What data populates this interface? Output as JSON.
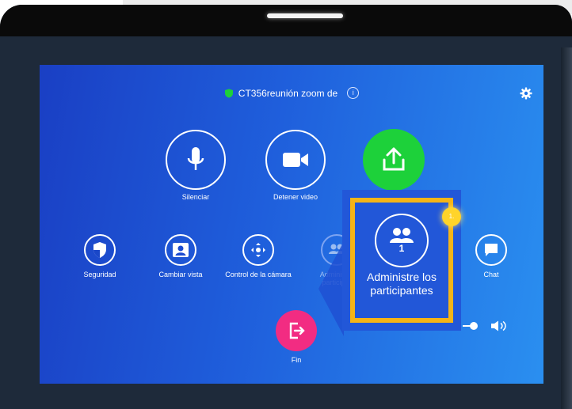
{
  "meeting": {
    "title": "CT356reunión zoom de",
    "info_symbol": "i"
  },
  "top_buttons": {
    "mute": "Silenciar",
    "stop_video": "Detener video"
  },
  "bottom_buttons": {
    "security": "Seguridad",
    "change_view": "Cambiar vista",
    "camera_control": "Control de la cámara",
    "manage_participants_1": "Administre",
    "manage_participants_2": "participar",
    "participants_count": "1",
    "chat": "Chat"
  },
  "end": {
    "label": "Fin"
  },
  "callout": {
    "count": "1",
    "line1": "Administre los",
    "line2": "participantes",
    "step": "1."
  },
  "volume": {
    "level": 0.4
  },
  "colors": {
    "share": "#1dd13a",
    "end": "#f22c82",
    "highlight": "#f5b417",
    "accent": "#ffd42a"
  },
  "icons": [
    "shield-icon",
    "info-icon",
    "gear-icon",
    "microphone-icon",
    "video-camera-icon",
    "share-screen-icon",
    "security-shield-icon",
    "change-view-icon",
    "camera-control-icon",
    "participants-icon",
    "chat-icon",
    "exit-icon",
    "speaker-icon"
  ]
}
